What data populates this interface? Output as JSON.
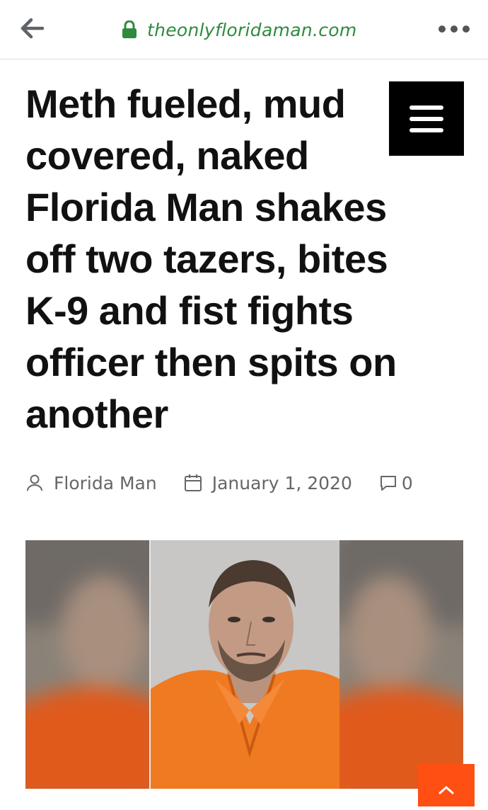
{
  "browser": {
    "url": "theonlyfloridaman.com",
    "back_icon": "arrow-left-icon",
    "lock_icon": "lock-icon",
    "more_icon": "more-horizontal-icon",
    "url_color": "#2e8b3d"
  },
  "article": {
    "headline": "Meth fueled, mud covered, naked Florida Man shakes off two tazers, bites K-9 and fist fights officer then spits on another",
    "author": "Florida Man",
    "date": "January 1, 2020",
    "comments": "0"
  },
  "menu": {
    "icon": "hamburger-menu-icon"
  },
  "image": {
    "description_icon": "featured-mugshot-image"
  },
  "scroll_top": {
    "icon": "chevron-up-icon",
    "color": "#ff4f12"
  }
}
